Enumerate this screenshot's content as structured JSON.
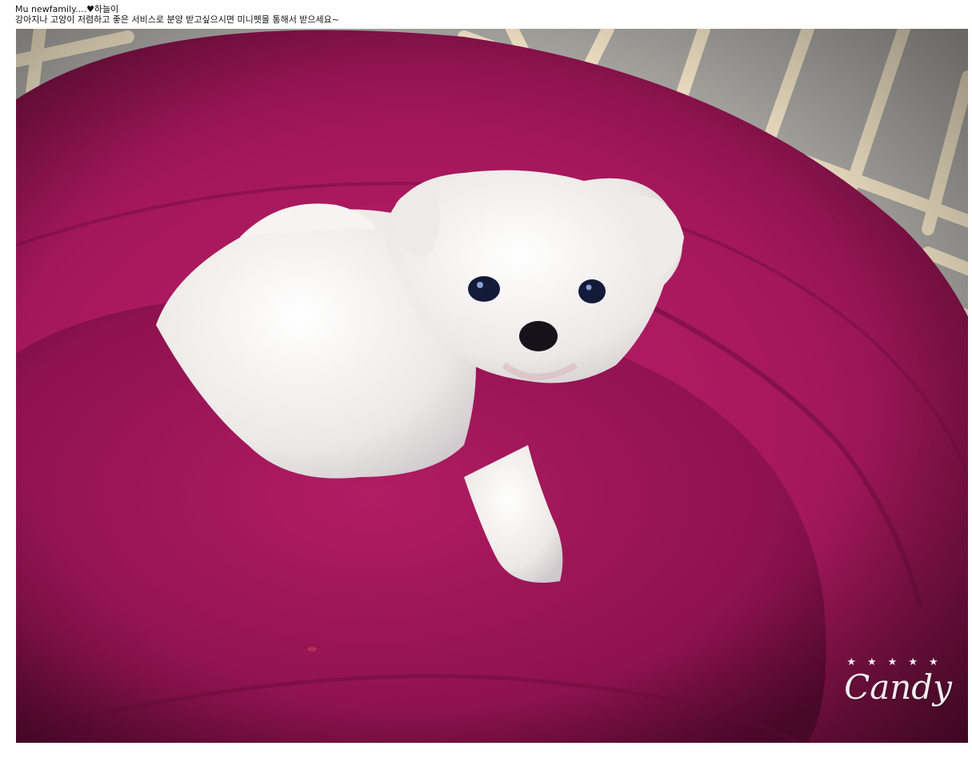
{
  "post": {
    "title": "Mu newfamily....♥하늘이",
    "description": "강아지나 고양이 저렴하고 좋은 서비스로 분양 받고싶으시면 미니펫몰 통해서 받으세요~"
  },
  "photo": {
    "subject": "white-puppy-on-pink-bed",
    "watermark_text": "Candy",
    "watermark_stars": "★★★★★"
  },
  "colors": {
    "bed": "#b0185f",
    "bed_dark": "#6a0d3a",
    "fence": "#f2e4c8",
    "puppy": "#f3f0ec"
  }
}
